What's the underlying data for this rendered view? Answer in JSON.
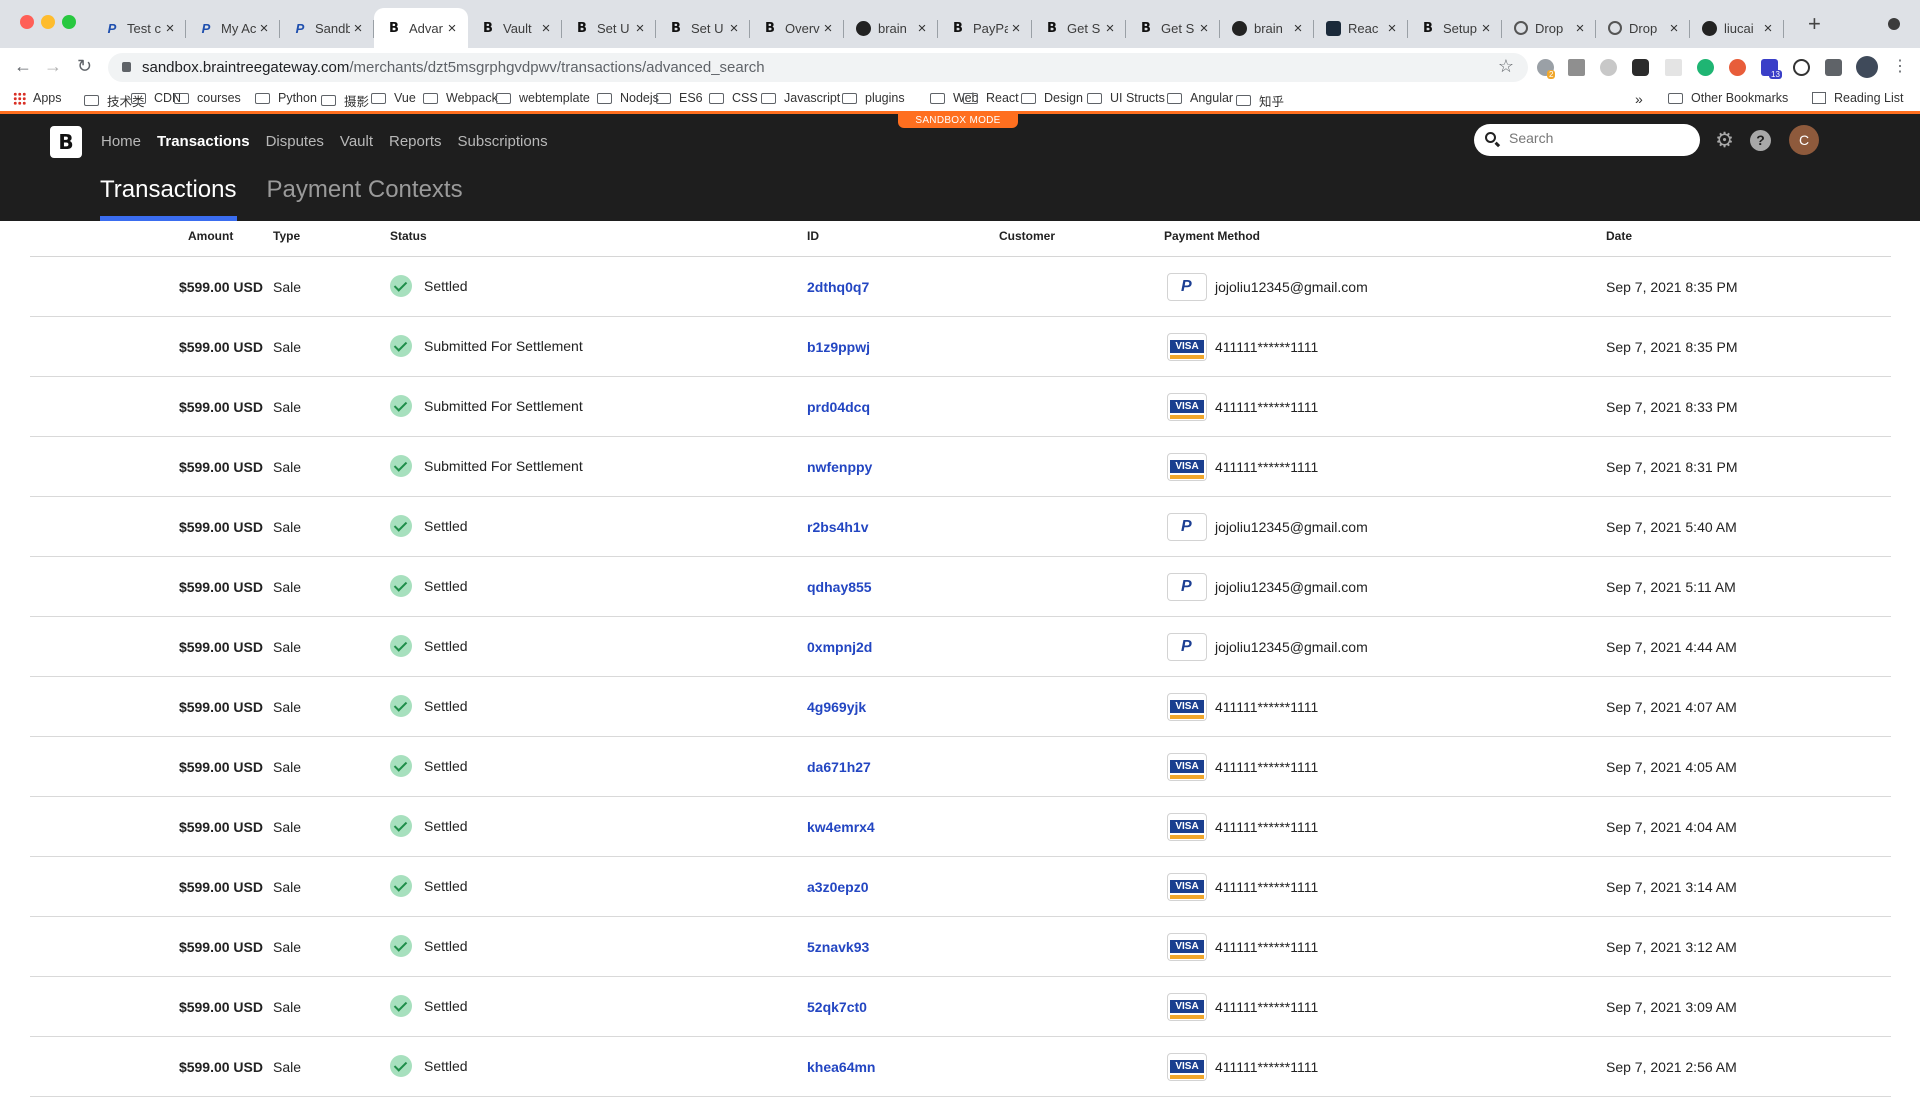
{
  "browser": {
    "tabs": [
      {
        "title": "Test c",
        "fav": "paypal",
        "active": false
      },
      {
        "title": "My Ac",
        "fav": "paypal",
        "active": false
      },
      {
        "title": "Sandb",
        "fav": "paypal",
        "active": false
      },
      {
        "title": "Advar",
        "fav": "braintree",
        "active": true
      },
      {
        "title": "Vault",
        "fav": "braintree",
        "active": false
      },
      {
        "title": "Set U",
        "fav": "braintree",
        "active": false
      },
      {
        "title": "Set U",
        "fav": "braintree",
        "active": false
      },
      {
        "title": "Overv",
        "fav": "braintree",
        "active": false
      },
      {
        "title": "brain",
        "fav": "github",
        "active": false
      },
      {
        "title": "PayPa",
        "fav": "braintree",
        "active": false
      },
      {
        "title": "Get S",
        "fav": "braintree",
        "active": false
      },
      {
        "title": "Get S",
        "fav": "braintree",
        "active": false
      },
      {
        "title": "brain",
        "fav": "github",
        "active": false
      },
      {
        "title": "Reac",
        "fav": "react",
        "active": false
      },
      {
        "title": "Setup",
        "fav": "braintree",
        "active": false
      },
      {
        "title": "Drop",
        "fav": "globe",
        "active": false
      },
      {
        "title": "Drop",
        "fav": "globe",
        "active": false
      },
      {
        "title": "liucai",
        "fav": "github",
        "active": false
      }
    ],
    "url_host": "sandbox.braintreegateway.com",
    "url_path": "/merchants/dzt5msgrphgvdpwv/transactions/advanced_search",
    "extension_badges": {
      "first": "2",
      "second": "13"
    },
    "bookmarks": [
      "Apps",
      "技术类",
      "CDN",
      "courses",
      "Python",
      "摄影",
      "Vue",
      "Webpack",
      "webtemplate",
      "Nodejs",
      "ES6",
      "CSS",
      "Javascript",
      "plugins",
      "Web",
      "React",
      "Design",
      "UI Structs",
      "Angular",
      "知乎"
    ],
    "bookmarks_overflow": "»",
    "other_bookmarks": "Other Bookmarks",
    "reading_list": "Reading List"
  },
  "app": {
    "sandbox_label": "SANDBOX MODE",
    "logo": "B",
    "nav": [
      "Home",
      "Transactions",
      "Disputes",
      "Vault",
      "Reports",
      "Subscriptions"
    ],
    "nav_active": "Transactions",
    "subtabs": [
      "Transactions",
      "Payment Contexts"
    ],
    "subtab_active": "Transactions",
    "search_placeholder": "Search",
    "avatar_initial": "C"
  },
  "table": {
    "headers": {
      "amount": "Amount",
      "type": "Type",
      "status": "Status",
      "id": "ID",
      "customer": "Customer",
      "payment_method": "Payment Method",
      "date": "Date"
    },
    "rows": [
      {
        "amount": "$599.00 USD",
        "type": "Sale",
        "status": "Settled",
        "id": "2dthq0q7",
        "customer": "",
        "pm_type": "paypal",
        "pm": "jojoliu12345@gmail.com",
        "date": "Sep 7, 2021 8:35 PM"
      },
      {
        "amount": "$599.00 USD",
        "type": "Sale",
        "status": "Submitted For Settlement",
        "id": "b1z9ppwj",
        "customer": "",
        "pm_type": "visa",
        "pm": "411111******1111",
        "date": "Sep 7, 2021 8:35 PM"
      },
      {
        "amount": "$599.00 USD",
        "type": "Sale",
        "status": "Submitted For Settlement",
        "id": "prd04dcq",
        "customer": "",
        "pm_type": "visa",
        "pm": "411111******1111",
        "date": "Sep 7, 2021 8:33 PM"
      },
      {
        "amount": "$599.00 USD",
        "type": "Sale",
        "status": "Submitted For Settlement",
        "id": "nwfenppy",
        "customer": "",
        "pm_type": "visa",
        "pm": "411111******1111",
        "date": "Sep 7, 2021 8:31 PM"
      },
      {
        "amount": "$599.00 USD",
        "type": "Sale",
        "status": "Settled",
        "id": "r2bs4h1v",
        "customer": "",
        "pm_type": "paypal",
        "pm": "jojoliu12345@gmail.com",
        "date": "Sep 7, 2021 5:40 AM"
      },
      {
        "amount": "$599.00 USD",
        "type": "Sale",
        "status": "Settled",
        "id": "qdhay855",
        "customer": "",
        "pm_type": "paypal",
        "pm": "jojoliu12345@gmail.com",
        "date": "Sep 7, 2021 5:11 AM"
      },
      {
        "amount": "$599.00 USD",
        "type": "Sale",
        "status": "Settled",
        "id": "0xmpnj2d",
        "customer": "",
        "pm_type": "paypal",
        "pm": "jojoliu12345@gmail.com",
        "date": "Sep 7, 2021 4:44 AM"
      },
      {
        "amount": "$599.00 USD",
        "type": "Sale",
        "status": "Settled",
        "id": "4g969yjk",
        "customer": "",
        "pm_type": "visa",
        "pm": "411111******1111",
        "date": "Sep 7, 2021 4:07 AM"
      },
      {
        "amount": "$599.00 USD",
        "type": "Sale",
        "status": "Settled",
        "id": "da671h27",
        "customer": "",
        "pm_type": "visa",
        "pm": "411111******1111",
        "date": "Sep 7, 2021 4:05 AM"
      },
      {
        "amount": "$599.00 USD",
        "type": "Sale",
        "status": "Settled",
        "id": "kw4emrx4",
        "customer": "",
        "pm_type": "visa",
        "pm": "411111******1111",
        "date": "Sep 7, 2021 4:04 AM"
      },
      {
        "amount": "$599.00 USD",
        "type": "Sale",
        "status": "Settled",
        "id": "a3z0epz0",
        "customer": "",
        "pm_type": "visa",
        "pm": "411111******1111",
        "date": "Sep 7, 2021 3:14 AM"
      },
      {
        "amount": "$599.00 USD",
        "type": "Sale",
        "status": "Settled",
        "id": "5znavk93",
        "customer": "",
        "pm_type": "visa",
        "pm": "411111******1111",
        "date": "Sep 7, 2021 3:12 AM"
      },
      {
        "amount": "$599.00 USD",
        "type": "Sale",
        "status": "Settled",
        "id": "52qk7ct0",
        "customer": "",
        "pm_type": "visa",
        "pm": "411111******1111",
        "date": "Sep 7, 2021 3:09 AM"
      },
      {
        "amount": "$599.00 USD",
        "type": "Sale",
        "status": "Settled",
        "id": "khea64mn",
        "customer": "",
        "pm_type": "visa",
        "pm": "411111******1111",
        "date": "Sep 7, 2021 2:56 AM"
      }
    ]
  }
}
